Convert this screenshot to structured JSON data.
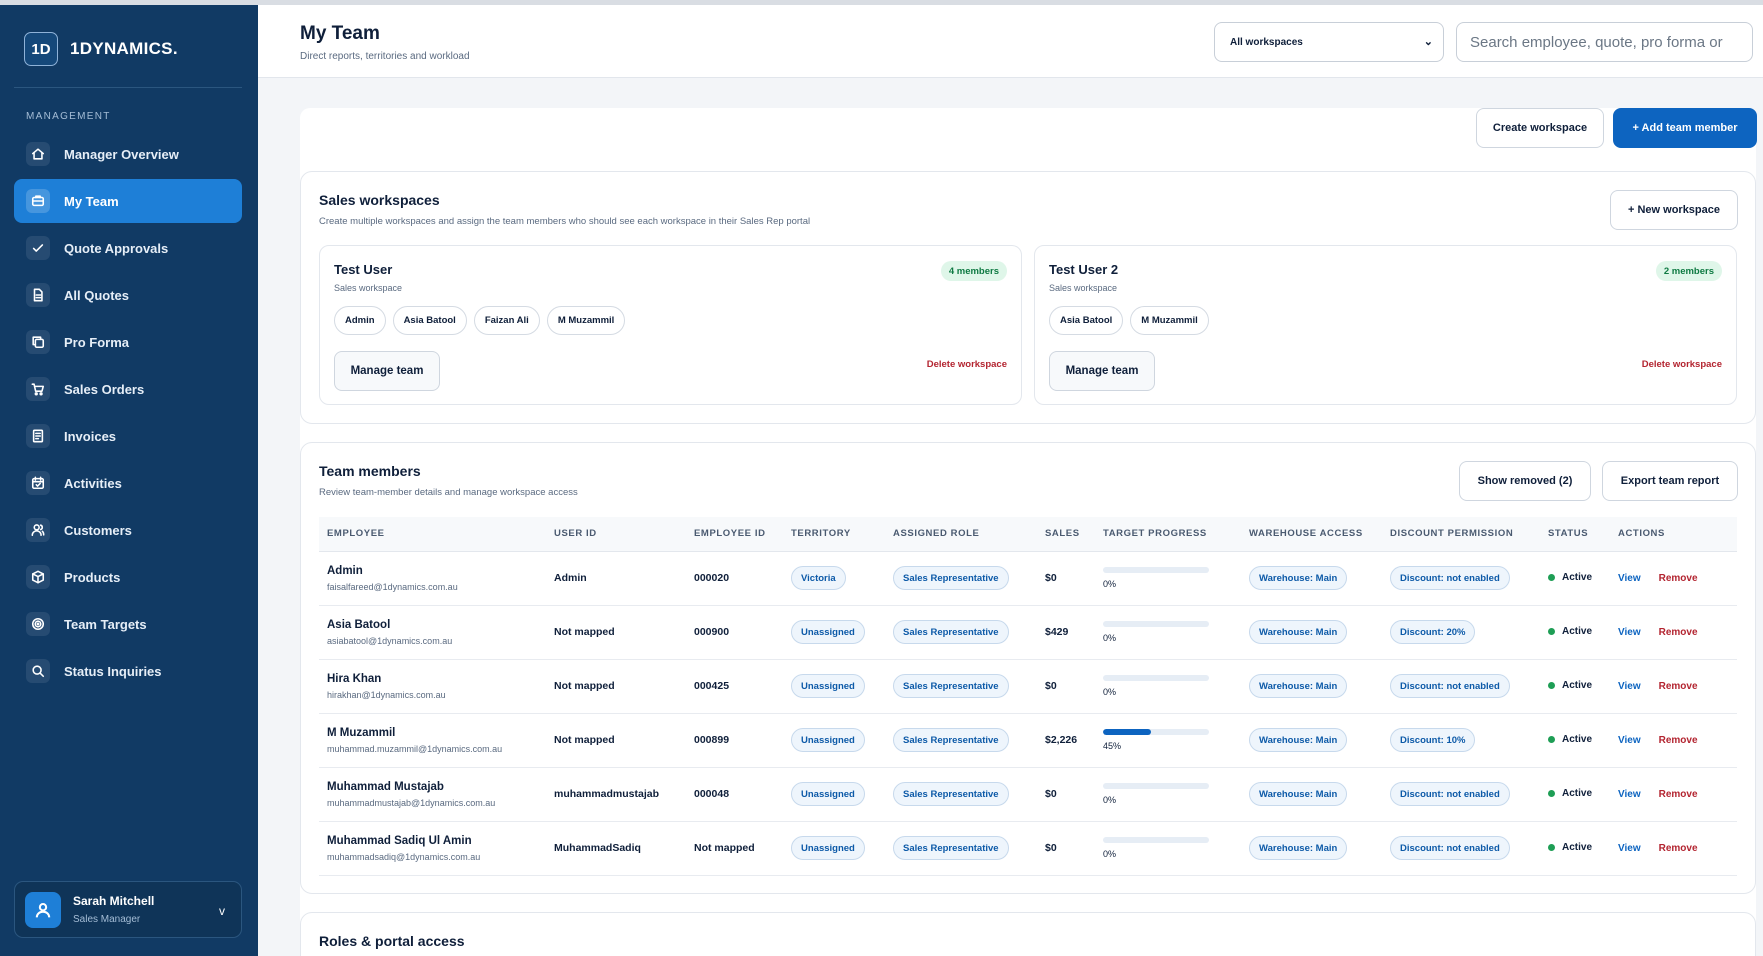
{
  "brand": {
    "badge": "1D",
    "name": "1DYNAMICS."
  },
  "sidebar": {
    "section_label": "MANAGEMENT",
    "items": [
      {
        "label": "Manager Overview",
        "icon": "home-icon"
      },
      {
        "label": "My Team",
        "icon": "team-icon",
        "active": true
      },
      {
        "label": "Quote Approvals",
        "icon": "check-icon"
      },
      {
        "label": "All Quotes",
        "icon": "document-icon"
      },
      {
        "label": "Pro Forma",
        "icon": "copy-icon"
      },
      {
        "label": "Sales Orders",
        "icon": "cart-icon"
      },
      {
        "label": "Invoices",
        "icon": "invoice-icon"
      },
      {
        "label": "Activities",
        "icon": "calendar-icon"
      },
      {
        "label": "Customers",
        "icon": "users-icon"
      },
      {
        "label": "Products",
        "icon": "box-icon"
      },
      {
        "label": "Team Targets",
        "icon": "target-icon"
      },
      {
        "label": "Status Inquiries",
        "icon": "search-icon"
      }
    ],
    "user": {
      "name": "Sarah Mitchell",
      "role": "Sales Manager",
      "chevron": "v"
    }
  },
  "header": {
    "title": "My Team",
    "subtitle": "Direct reports, territories and workload",
    "workspace_select": "All workspaces",
    "search_placeholder": "Search employee, quote, pro forma or"
  },
  "actions": {
    "create_workspace": "Create workspace",
    "add_member": "+ Add team member"
  },
  "workspaces": {
    "title": "Sales workspaces",
    "subtitle": "Create multiple workspaces and assign the team members who should see each workspace in their Sales Rep portal",
    "new_button": "+ New workspace",
    "cards": [
      {
        "name": "Test User",
        "type": "Sales workspace",
        "count": "4 members",
        "members": [
          "Admin",
          "Asia Batool",
          "Faizan Ali",
          "M Muzammil"
        ],
        "manage": "Manage team",
        "delete": "Delete workspace"
      },
      {
        "name": "Test User 2",
        "type": "Sales workspace",
        "count": "2 members",
        "members": [
          "Asia Batool",
          "M Muzammil"
        ],
        "manage": "Manage team",
        "delete": "Delete workspace"
      }
    ]
  },
  "team": {
    "title": "Team members",
    "subtitle": "Review team-member details and manage workspace access",
    "show_removed": "Show removed (2)",
    "export": "Export team report",
    "columns": [
      "EMPLOYEE",
      "USER ID",
      "EMPLOYEE ID",
      "TERRITORY",
      "ASSIGNED ROLE",
      "SALES",
      "TARGET PROGRESS",
      "WAREHOUSE ACCESS",
      "DISCOUNT PERMISSION",
      "STATUS",
      "ACTIONS"
    ],
    "rows": [
      {
        "name": "Admin",
        "email": "faisalfareed@1dynamics.com.au",
        "user_id": "Admin",
        "employee_id": "000020",
        "territory": "Victoria",
        "role": "Sales Representative",
        "sales": "$0",
        "progress": 0,
        "progress_label": "0%",
        "warehouse": "Warehouse: Main",
        "discount": "Discount: not enabled",
        "status": "Active",
        "view": "View",
        "remove": "Remove"
      },
      {
        "name": "Asia Batool",
        "email": "asiabatool@1dynamics.com.au",
        "user_id": "Not mapped",
        "employee_id": "000900",
        "territory": "Unassigned",
        "role": "Sales Representative",
        "sales": "$429",
        "progress": 0,
        "progress_label": "0%",
        "warehouse": "Warehouse: Main",
        "discount": "Discount: 20%",
        "status": "Active",
        "view": "View",
        "remove": "Remove"
      },
      {
        "name": "Hira Khan",
        "email": "hirakhan@1dynamics.com.au",
        "user_id": "Not mapped",
        "employee_id": "000425",
        "territory": "Unassigned",
        "role": "Sales Representative",
        "sales": "$0",
        "progress": 0,
        "progress_label": "0%",
        "warehouse": "Warehouse: Main",
        "discount": "Discount: not enabled",
        "status": "Active",
        "view": "View",
        "remove": "Remove"
      },
      {
        "name": "M Muzammil",
        "email": "muhammad.muzammil@1dynamics.com.au",
        "user_id": "Not mapped",
        "employee_id": "000899",
        "territory": "Unassigned",
        "role": "Sales Representative",
        "sales": "$2,226",
        "progress": 45,
        "progress_label": "45%",
        "warehouse": "Warehouse: Main",
        "discount": "Discount: 10%",
        "status": "Active",
        "view": "View",
        "remove": "Remove"
      },
      {
        "name": "Muhammad Mustajab",
        "email": "muhammadmustajab@1dynamics.com.au",
        "user_id": "muhammadmustajab",
        "employee_id": "000048",
        "territory": "Unassigned",
        "role": "Sales Representative",
        "sales": "$0",
        "progress": 0,
        "progress_label": "0%",
        "warehouse": "Warehouse: Main",
        "discount": "Discount: not enabled",
        "status": "Active",
        "view": "View",
        "remove": "Remove"
      },
      {
        "name": "Muhammad Sadiq Ul Amin",
        "email": "muhammadsadiq@1dynamics.com.au",
        "user_id": "MuhammadSadiq",
        "employee_id": "Not mapped",
        "territory": "Unassigned",
        "role": "Sales Representative",
        "sales": "$0",
        "progress": 0,
        "progress_label": "0%",
        "warehouse": "Warehouse: Main",
        "discount": "Discount: not enabled",
        "status": "Active",
        "view": "View",
        "remove": "Remove"
      }
    ]
  },
  "roles": {
    "title": "Roles & portal access"
  }
}
